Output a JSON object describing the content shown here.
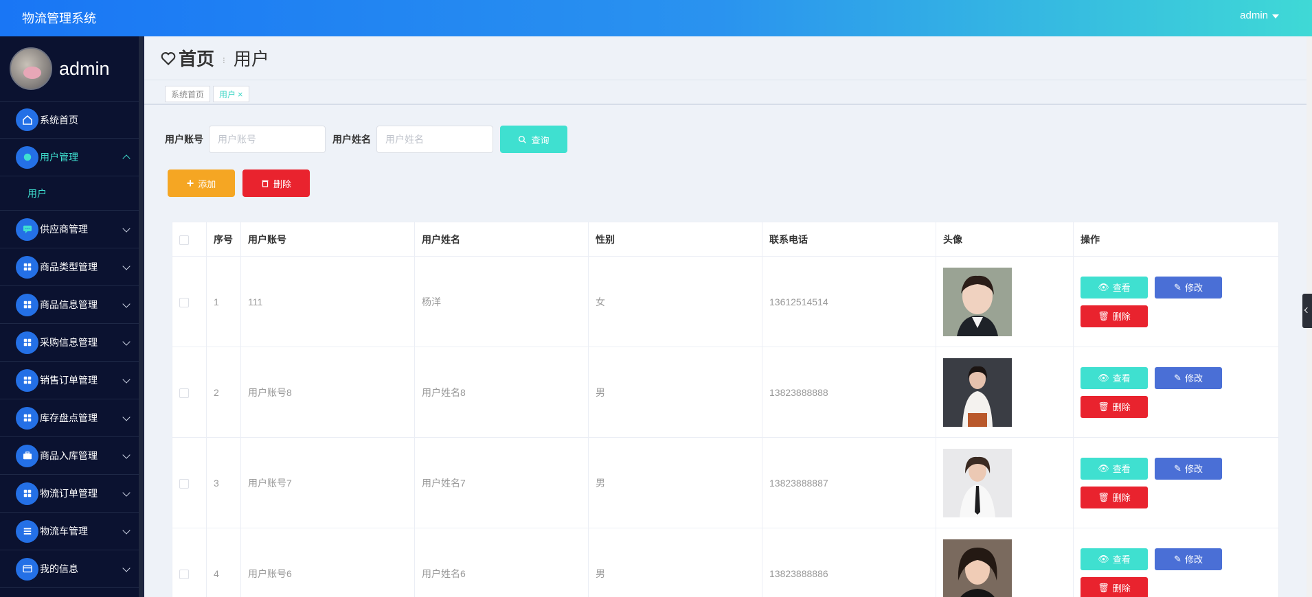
{
  "header": {
    "title": "物流管理系统",
    "user": "admin"
  },
  "sidebar": {
    "username": "admin",
    "items": [
      {
        "label": "系统首页",
        "icon": "home-icon"
      },
      {
        "label": "用户管理",
        "icon": "user-icon",
        "expanded": true,
        "children": [
          {
            "label": "用户"
          }
        ]
      },
      {
        "label": "供应商管理",
        "icon": "chat-icon"
      },
      {
        "label": "商品类型管理",
        "icon": "grid-icon"
      },
      {
        "label": "商品信息管理",
        "icon": "grid-icon"
      },
      {
        "label": "采购信息管理",
        "icon": "grid-icon"
      },
      {
        "label": "销售订单管理",
        "icon": "grid-icon"
      },
      {
        "label": "库存盘点管理",
        "icon": "grid-icon"
      },
      {
        "label": "商品入库管理",
        "icon": "briefcase-icon"
      },
      {
        "label": "物流订单管理",
        "icon": "grid-icon"
      },
      {
        "label": "物流车管理",
        "icon": "list-icon"
      },
      {
        "label": "我的信息",
        "icon": "card-icon"
      }
    ]
  },
  "page": {
    "home": "首页",
    "crumb": "用户",
    "tabs": [
      {
        "label": "系统首页"
      },
      {
        "label": "用户"
      }
    ]
  },
  "search": {
    "account_label": "用户账号",
    "account_placeholder": "用户账号",
    "account_value": "",
    "name_label": "用户姓名",
    "name_placeholder": "用户姓名",
    "name_value": "",
    "query_label": "查询"
  },
  "actions": {
    "add_label": "添加",
    "delete_label": "删除"
  },
  "table": {
    "columns": [
      "序号",
      "用户账号",
      "用户姓名",
      "性别",
      "联系电话",
      "头像",
      "操作"
    ],
    "rows": [
      {
        "no": "1",
        "account": "111",
        "name": "杨洋",
        "gender": "女",
        "phone": "13612514514"
      },
      {
        "no": "2",
        "account": "用户账号8",
        "name": "用户姓名8",
        "gender": "男",
        "phone": "13823888888"
      },
      {
        "no": "3",
        "account": "用户账号7",
        "name": "用户姓名7",
        "gender": "男",
        "phone": "13823888887"
      },
      {
        "no": "4",
        "account": "用户账号6",
        "name": "用户姓名6",
        "gender": "男",
        "phone": "13823888886"
      }
    ],
    "row_actions": {
      "view": "查看",
      "edit": "修改",
      "delete": "删除"
    }
  },
  "colors": {
    "primary": "#2470e6",
    "accent": "#3fe0d0",
    "warning": "#f5a623",
    "danger": "#e9232e",
    "edit": "#4a6fd6",
    "sidebar_bg": "#0b1230"
  }
}
